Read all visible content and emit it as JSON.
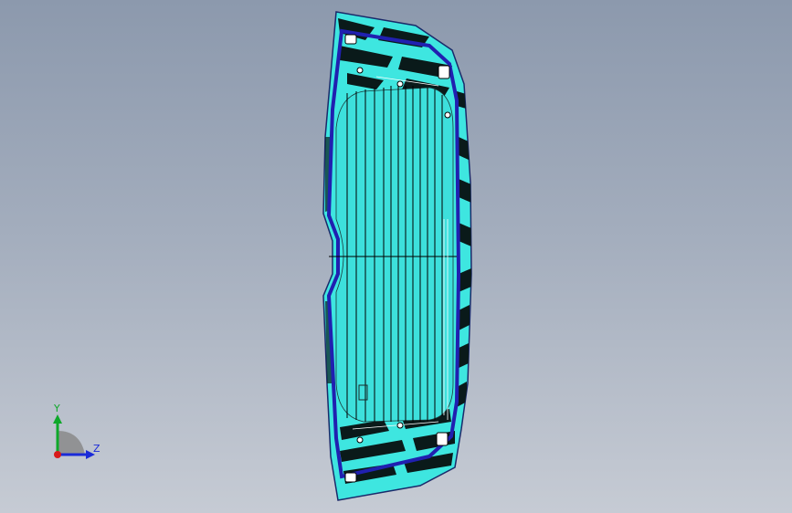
{
  "viewport": {
    "background_top": "#8c99ad",
    "background_bottom": "#c6cbd4"
  },
  "model": {
    "description_icon": "rear-window-glass-part-icon",
    "colors": {
      "glass": "#3ee6e0",
      "glass_edge": "#2ec9c4",
      "frame_outline": "#2020b0",
      "dark_strips": "#0a1a1a",
      "heater_lines": "#000000"
    }
  },
  "triad": {
    "y_label": "Y",
    "z_label": "Z",
    "colors": {
      "y": "#0ea82a",
      "z": "#1a2ad8",
      "origin": "#d81a1a",
      "plane": "#8a8a8a"
    }
  }
}
